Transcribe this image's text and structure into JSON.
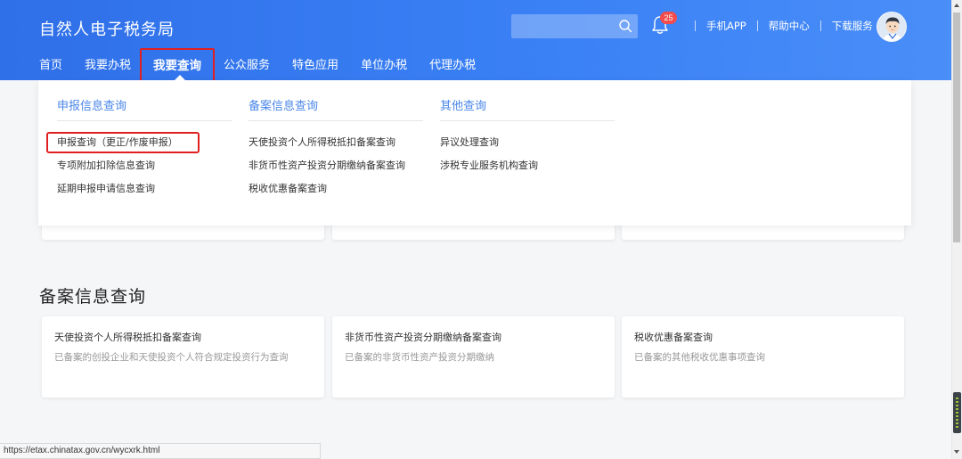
{
  "header": {
    "site_title": "自然人电子税务局",
    "search_placeholder": "",
    "notification_count": "25",
    "links": [
      "手机APP",
      "帮助中心",
      "下载服务"
    ],
    "icons": [
      "search-icon",
      "bell-icon",
      "avatar"
    ]
  },
  "nav": {
    "items": [
      "首页",
      "我要办税",
      "我要查询",
      "公众服务",
      "特色应用",
      "单位办税",
      "代理办税"
    ],
    "active": "我要查询"
  },
  "dropdown": {
    "columns": [
      {
        "title": "申报信息查询",
        "items": [
          "申报查询（更正/作废申报）",
          "专项附加扣除信息查询",
          "延期申报申请信息查询"
        ]
      },
      {
        "title": "备案信息查询",
        "items": [
          "天使投资个人所得税抵扣备案查询",
          "非货币性资产投资分期缴纳备案查询",
          "税收优惠备案查询"
        ]
      },
      {
        "title": "其他查询",
        "items": [
          "异议处理查询",
          "涉税专业服务机构查询"
        ]
      }
    ]
  },
  "section": {
    "title": "备案信息查询",
    "cards": [
      {
        "title": "天使投资个人所得税抵扣备案查询",
        "desc": "已备案的创投企业和天使投资个人符合规定投资行为查询"
      },
      {
        "title": "非货币性资产投资分期缴纳备案查询",
        "desc": "已备案的非货币性资产投资分期缴纳"
      },
      {
        "title": "税收优惠备案查询",
        "desc": "已备案的其他税收优惠事项查询"
      }
    ]
  },
  "status_bar": {
    "url": "https://etax.chinatax.gov.cn/wycxrk.html"
  },
  "colors": {
    "header_blue": "#3b82f6",
    "accent_text": "#4a86e8",
    "highlight_red": "#e02020",
    "badge_red": "#f24c4c"
  }
}
